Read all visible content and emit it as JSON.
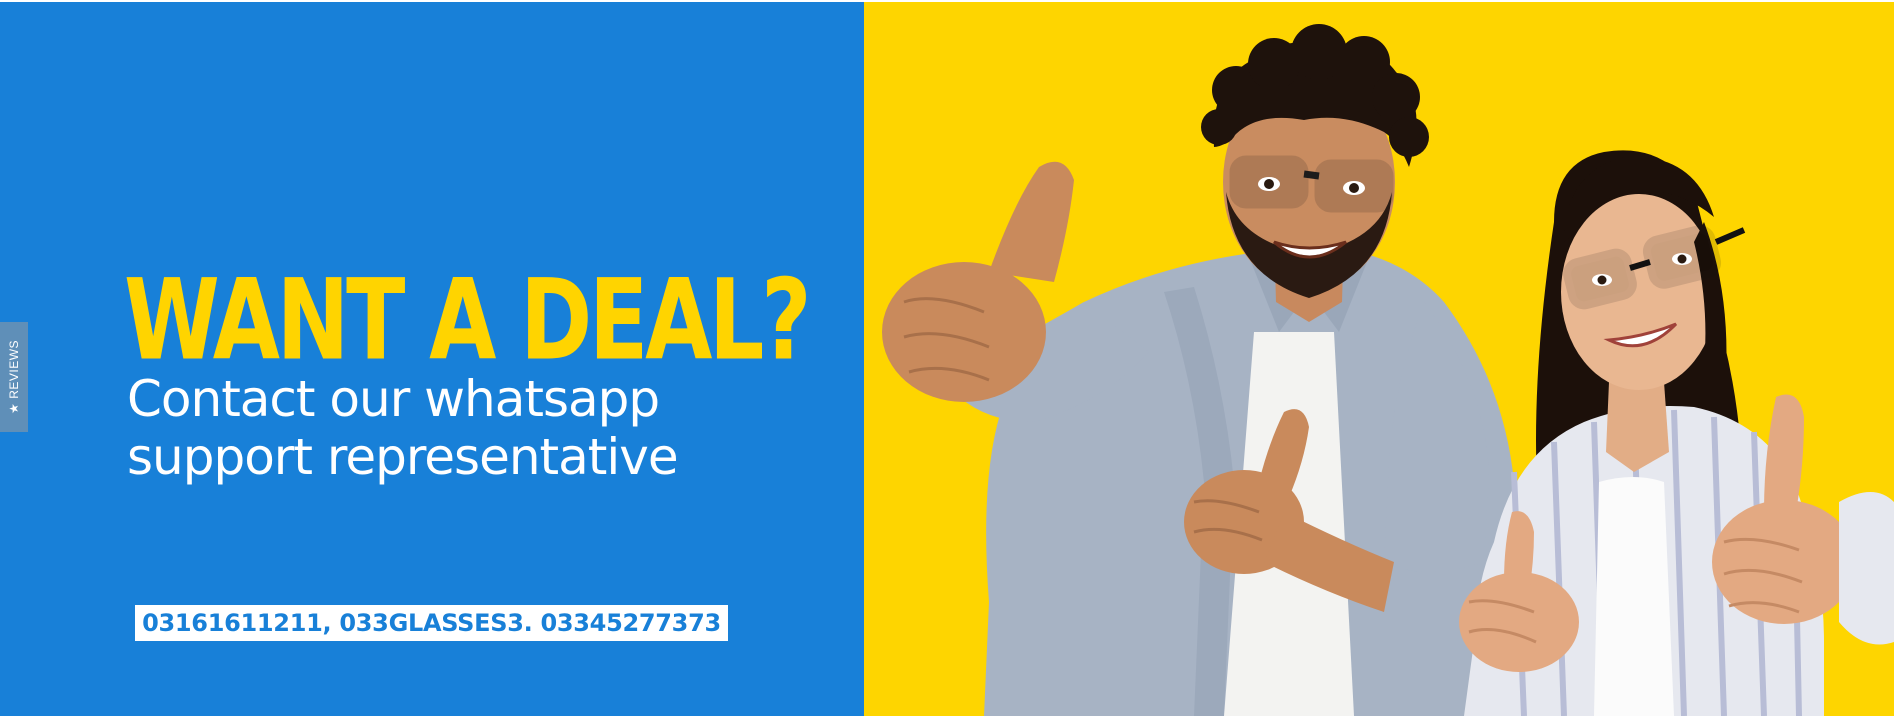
{
  "banner": {
    "headline": "WANT A DEAL?",
    "subline_line1": "Contact our whatsapp",
    "subline_line2": "support representative",
    "phones": "03161611211, 033GLASSES3. 03345277373",
    "reviews_tab": "REVIEWS",
    "reviews_icon": "star-icon"
  },
  "colors": {
    "left_bg": "#1880d8",
    "right_bg": "#fed500",
    "headline": "#ffd400",
    "subline": "#ffffff",
    "phone_text": "#1880d8"
  }
}
